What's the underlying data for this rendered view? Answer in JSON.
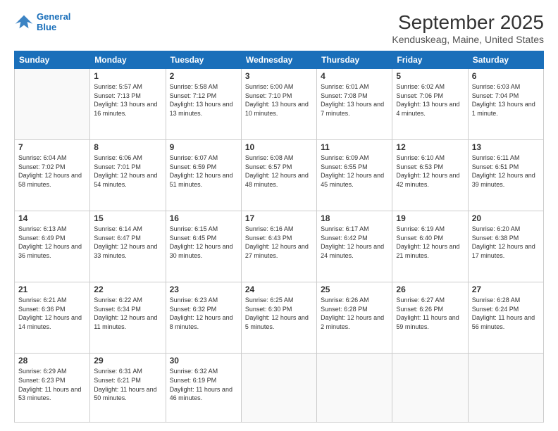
{
  "logo": {
    "line1": "General",
    "line2": "Blue"
  },
  "title": "September 2025",
  "subtitle": "Kenduskeag, Maine, United States",
  "weekdays": [
    "Sunday",
    "Monday",
    "Tuesday",
    "Wednesday",
    "Thursday",
    "Friday",
    "Saturday"
  ],
  "weeks": [
    [
      {
        "num": "",
        "sunrise": "",
        "sunset": "",
        "daylight": ""
      },
      {
        "num": "1",
        "sunrise": "Sunrise: 5:57 AM",
        "sunset": "Sunset: 7:13 PM",
        "daylight": "Daylight: 13 hours and 16 minutes."
      },
      {
        "num": "2",
        "sunrise": "Sunrise: 5:58 AM",
        "sunset": "Sunset: 7:12 PM",
        "daylight": "Daylight: 13 hours and 13 minutes."
      },
      {
        "num": "3",
        "sunrise": "Sunrise: 6:00 AM",
        "sunset": "Sunset: 7:10 PM",
        "daylight": "Daylight: 13 hours and 10 minutes."
      },
      {
        "num": "4",
        "sunrise": "Sunrise: 6:01 AM",
        "sunset": "Sunset: 7:08 PM",
        "daylight": "Daylight: 13 hours and 7 minutes."
      },
      {
        "num": "5",
        "sunrise": "Sunrise: 6:02 AM",
        "sunset": "Sunset: 7:06 PM",
        "daylight": "Daylight: 13 hours and 4 minutes."
      },
      {
        "num": "6",
        "sunrise": "Sunrise: 6:03 AM",
        "sunset": "Sunset: 7:04 PM",
        "daylight": "Daylight: 13 hours and 1 minute."
      }
    ],
    [
      {
        "num": "7",
        "sunrise": "Sunrise: 6:04 AM",
        "sunset": "Sunset: 7:02 PM",
        "daylight": "Daylight: 12 hours and 58 minutes."
      },
      {
        "num": "8",
        "sunrise": "Sunrise: 6:06 AM",
        "sunset": "Sunset: 7:01 PM",
        "daylight": "Daylight: 12 hours and 54 minutes."
      },
      {
        "num": "9",
        "sunrise": "Sunrise: 6:07 AM",
        "sunset": "Sunset: 6:59 PM",
        "daylight": "Daylight: 12 hours and 51 minutes."
      },
      {
        "num": "10",
        "sunrise": "Sunrise: 6:08 AM",
        "sunset": "Sunset: 6:57 PM",
        "daylight": "Daylight: 12 hours and 48 minutes."
      },
      {
        "num": "11",
        "sunrise": "Sunrise: 6:09 AM",
        "sunset": "Sunset: 6:55 PM",
        "daylight": "Daylight: 12 hours and 45 minutes."
      },
      {
        "num": "12",
        "sunrise": "Sunrise: 6:10 AM",
        "sunset": "Sunset: 6:53 PM",
        "daylight": "Daylight: 12 hours and 42 minutes."
      },
      {
        "num": "13",
        "sunrise": "Sunrise: 6:11 AM",
        "sunset": "Sunset: 6:51 PM",
        "daylight": "Daylight: 12 hours and 39 minutes."
      }
    ],
    [
      {
        "num": "14",
        "sunrise": "Sunrise: 6:13 AM",
        "sunset": "Sunset: 6:49 PM",
        "daylight": "Daylight: 12 hours and 36 minutes."
      },
      {
        "num": "15",
        "sunrise": "Sunrise: 6:14 AM",
        "sunset": "Sunset: 6:47 PM",
        "daylight": "Daylight: 12 hours and 33 minutes."
      },
      {
        "num": "16",
        "sunrise": "Sunrise: 6:15 AM",
        "sunset": "Sunset: 6:45 PM",
        "daylight": "Daylight: 12 hours and 30 minutes."
      },
      {
        "num": "17",
        "sunrise": "Sunrise: 6:16 AM",
        "sunset": "Sunset: 6:43 PM",
        "daylight": "Daylight: 12 hours and 27 minutes."
      },
      {
        "num": "18",
        "sunrise": "Sunrise: 6:17 AM",
        "sunset": "Sunset: 6:42 PM",
        "daylight": "Daylight: 12 hours and 24 minutes."
      },
      {
        "num": "19",
        "sunrise": "Sunrise: 6:19 AM",
        "sunset": "Sunset: 6:40 PM",
        "daylight": "Daylight: 12 hours and 21 minutes."
      },
      {
        "num": "20",
        "sunrise": "Sunrise: 6:20 AM",
        "sunset": "Sunset: 6:38 PM",
        "daylight": "Daylight: 12 hours and 17 minutes."
      }
    ],
    [
      {
        "num": "21",
        "sunrise": "Sunrise: 6:21 AM",
        "sunset": "Sunset: 6:36 PM",
        "daylight": "Daylight: 12 hours and 14 minutes."
      },
      {
        "num": "22",
        "sunrise": "Sunrise: 6:22 AM",
        "sunset": "Sunset: 6:34 PM",
        "daylight": "Daylight: 12 hours and 11 minutes."
      },
      {
        "num": "23",
        "sunrise": "Sunrise: 6:23 AM",
        "sunset": "Sunset: 6:32 PM",
        "daylight": "Daylight: 12 hours and 8 minutes."
      },
      {
        "num": "24",
        "sunrise": "Sunrise: 6:25 AM",
        "sunset": "Sunset: 6:30 PM",
        "daylight": "Daylight: 12 hours and 5 minutes."
      },
      {
        "num": "25",
        "sunrise": "Sunrise: 6:26 AM",
        "sunset": "Sunset: 6:28 PM",
        "daylight": "Daylight: 12 hours and 2 minutes."
      },
      {
        "num": "26",
        "sunrise": "Sunrise: 6:27 AM",
        "sunset": "Sunset: 6:26 PM",
        "daylight": "Daylight: 11 hours and 59 minutes."
      },
      {
        "num": "27",
        "sunrise": "Sunrise: 6:28 AM",
        "sunset": "Sunset: 6:24 PM",
        "daylight": "Daylight: 11 hours and 56 minutes."
      }
    ],
    [
      {
        "num": "28",
        "sunrise": "Sunrise: 6:29 AM",
        "sunset": "Sunset: 6:23 PM",
        "daylight": "Daylight: 11 hours and 53 minutes."
      },
      {
        "num": "29",
        "sunrise": "Sunrise: 6:31 AM",
        "sunset": "Sunset: 6:21 PM",
        "daylight": "Daylight: 11 hours and 50 minutes."
      },
      {
        "num": "30",
        "sunrise": "Sunrise: 6:32 AM",
        "sunset": "Sunset: 6:19 PM",
        "daylight": "Daylight: 11 hours and 46 minutes."
      },
      {
        "num": "",
        "sunrise": "",
        "sunset": "",
        "daylight": ""
      },
      {
        "num": "",
        "sunrise": "",
        "sunset": "",
        "daylight": ""
      },
      {
        "num": "",
        "sunrise": "",
        "sunset": "",
        "daylight": ""
      },
      {
        "num": "",
        "sunrise": "",
        "sunset": "",
        "daylight": ""
      }
    ]
  ]
}
